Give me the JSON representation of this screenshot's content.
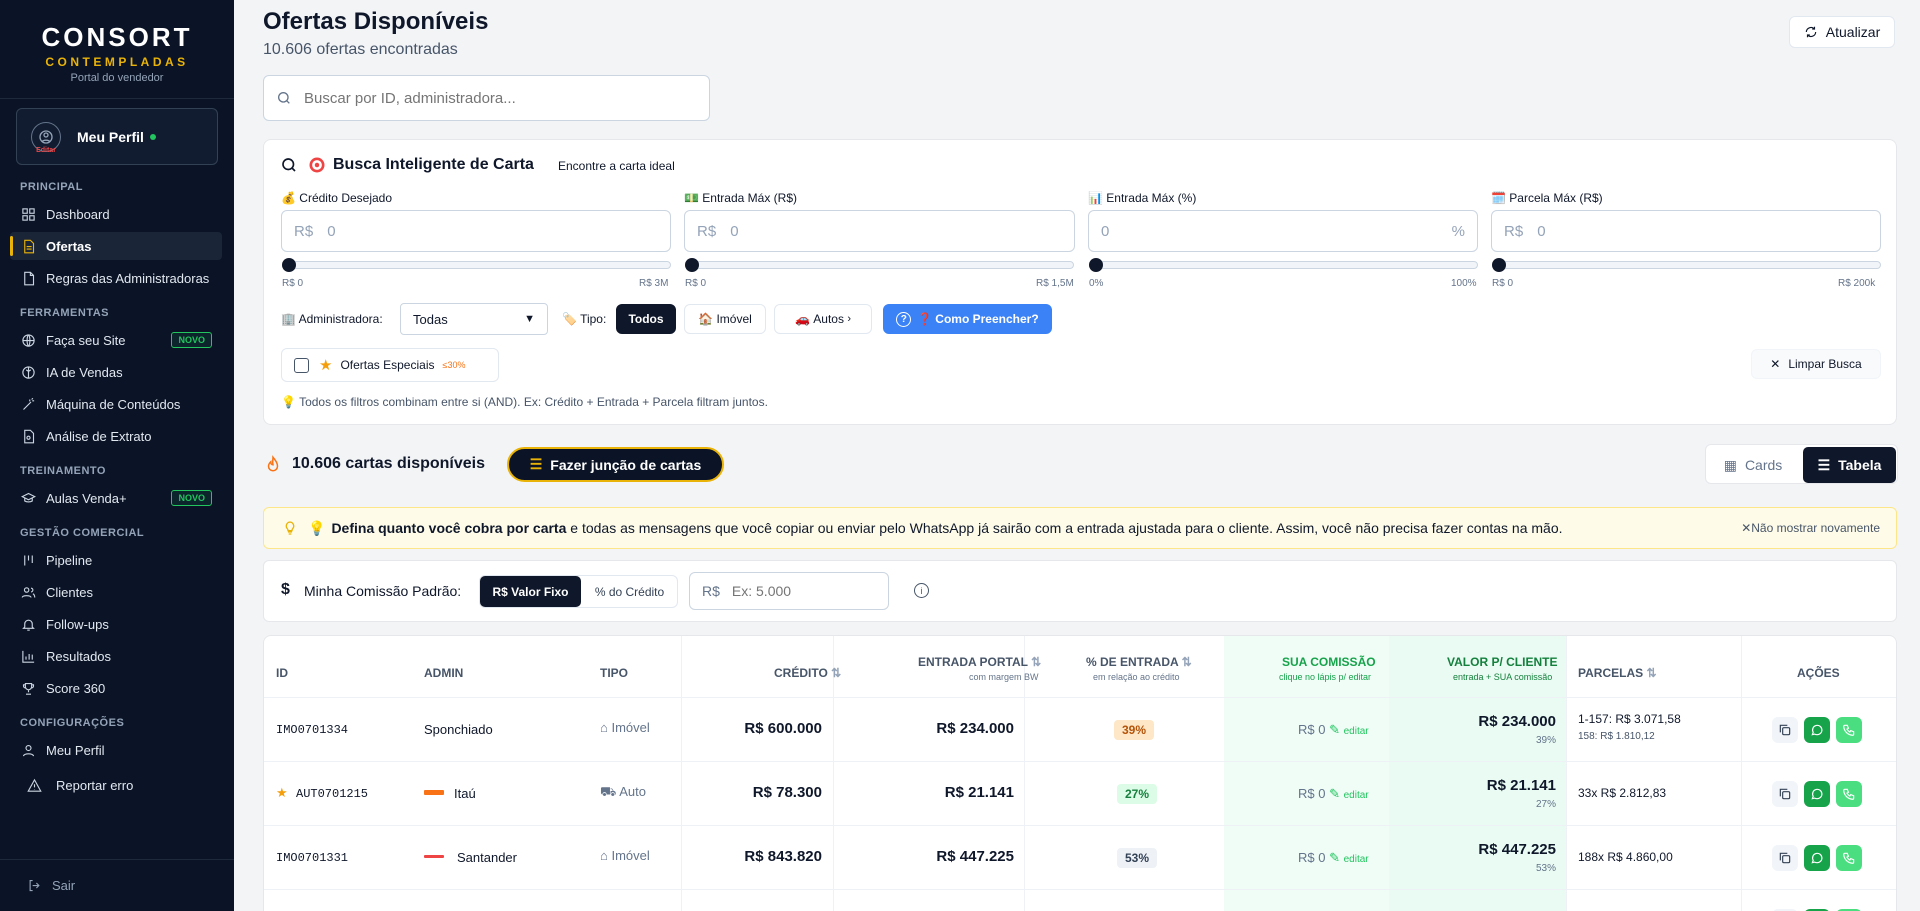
{
  "sidebar": {
    "brand": "CONSORT",
    "brand_sub": "CONTEMPLADAS",
    "tagline": "Portal do vendedor",
    "profile": {
      "name": "Meu Perfil",
      "edit": "Editar"
    },
    "sections": {
      "principal": "PRINCIPAL",
      "ferramentas": "FERRAMENTAS",
      "treinamento": "TREINAMENTO",
      "gestao": "GESTÃO COMERCIAL",
      "config": "CONFIGURAÇÕES"
    },
    "items": {
      "dashboard": "Dashboard",
      "ofertas": "Ofertas",
      "regras": "Regras das Administradoras",
      "site": "Faça seu Site",
      "ia": "IA de Vendas",
      "maquina": "Máquina de Conteúdos",
      "extrato": "Análise de Extrato",
      "aulas": "Aulas Venda+",
      "pipeline": "Pipeline",
      "clientes": "Clientes",
      "followups": "Follow-ups",
      "resultados": "Resultados",
      "score": "Score 360",
      "perfil": "Meu Perfil",
      "erro": "Reportar erro"
    },
    "badge_novo": "NOVO",
    "logout": "Sair"
  },
  "header": {
    "title": "Ofertas Disponíveis",
    "subtitle": "10.606 ofertas encontradas",
    "refresh": "Atualizar",
    "search_placeholder": "Buscar por ID, administradora..."
  },
  "smart_search": {
    "title": "Busca Inteligente de Carta",
    "subtitle": "Encontre a carta ideal",
    "fields": [
      {
        "label": "Crédito Desejado",
        "prefix": "R$",
        "value": "0",
        "min": "R$ 0",
        "max": "R$ 3M"
      },
      {
        "label": "Entrada Máx (R$)",
        "prefix": "R$",
        "value": "0",
        "min": "R$ 0",
        "max": "R$ 1,5M"
      },
      {
        "label": "Entrada Máx (%)",
        "prefix": "",
        "value": "0",
        "suffix": "%",
        "min": "0%",
        "max": "100%"
      },
      {
        "label": "Parcela Máx (R$)",
        "prefix": "R$",
        "value": "0",
        "min": "R$ 0",
        "max": "R$ 200k"
      }
    ],
    "admin_label": "Administradora:",
    "admin_value": "Todas",
    "tipo_label": "Tipo:",
    "tipo_options": [
      "Todos",
      "Imóvel",
      "Autos"
    ],
    "help_button": "Como Preencher?",
    "special_offers": "Ofertas Especiais",
    "special_badge": "≤30%",
    "clear": "Limpar Busca",
    "hint": "Todos os filtros combinam entre si (AND). Ex: Crédito + Entrada + Parcela filtram juntos."
  },
  "results": {
    "count": "10.606 cartas disponíveis",
    "join_button": "Fazer junção de cartas",
    "view_cards": "Cards",
    "view_table": "Tabela"
  },
  "tip": {
    "bold": "Defina quanto você cobra por carta",
    "text": " e todas as mensagens que você copiar ou enviar pelo WhatsApp já sairão com a entrada ajustada para o cliente. Assim, você não precisa fazer contas na mão.",
    "dismiss": "Não mostrar novamente"
  },
  "commission": {
    "label": "Minha Comissão Padrão:",
    "opt_fixed": "R$ Valor Fixo",
    "opt_pct": "% do Crédito",
    "prefix": "R$",
    "placeholder": "Ex: 5.000"
  },
  "table": {
    "headers": {
      "id": "ID",
      "admin": "ADMIN",
      "tipo": "TIPO",
      "credito": "CRÉDITO",
      "entrada": "ENTRADA PORTAL",
      "entrada_sub": "com margem BW",
      "pct": "% DE ENTRADA",
      "pct_sub": "em relação ao crédito",
      "comissao": "SUA COMISSÃO",
      "comissao_sub": "clique no lápis p/ editar",
      "cliente": "VALOR P/ CLIENTE",
      "cliente_sub": "entrada + SUA comissão",
      "parcelas": "PARCELAS",
      "acoes": "AÇÕES"
    },
    "edit": "editar",
    "rows": [
      {
        "id": "IMO0701334",
        "star": false,
        "admin": "Sponchiado",
        "tipo": "Imóvel",
        "credito": "R$ 600.000",
        "entrada": "R$ 234.000",
        "pct": "39%",
        "pct_color": "#fde7c7",
        "pct_text": "#b45309",
        "comissao": "R$ 0",
        "cliente": "R$ 234.000",
        "cliente_pct": "39%",
        "parcela1": "1-157: R$ 3.071,58",
        "parcela2": "158: R$ 1.810,12"
      },
      {
        "id": "AUT0701215",
        "star": true,
        "admin": "Itaú",
        "tipo": "Auto",
        "credito": "R$ 78.300",
        "entrada": "R$ 21.141",
        "pct": "27%",
        "pct_color": "#dcfce7",
        "pct_text": "#15803d",
        "comissao": "R$ 0",
        "cliente": "R$ 21.141",
        "cliente_pct": "27%",
        "parcela1": "33x R$ 2.812,83",
        "parcela2": ""
      },
      {
        "id": "IMO0701331",
        "star": false,
        "admin": "Santander",
        "tipo": "Imóvel",
        "credito": "R$ 843.820",
        "entrada": "R$ 447.225",
        "pct": "53%",
        "pct_color": "#eef2f7",
        "pct_text": "#334155",
        "comissao": "R$ 0",
        "cliente": "R$ 447.225",
        "cliente_pct": "53%",
        "parcela1": "188x R$ 4.860,00",
        "parcela2": ""
      }
    ]
  }
}
